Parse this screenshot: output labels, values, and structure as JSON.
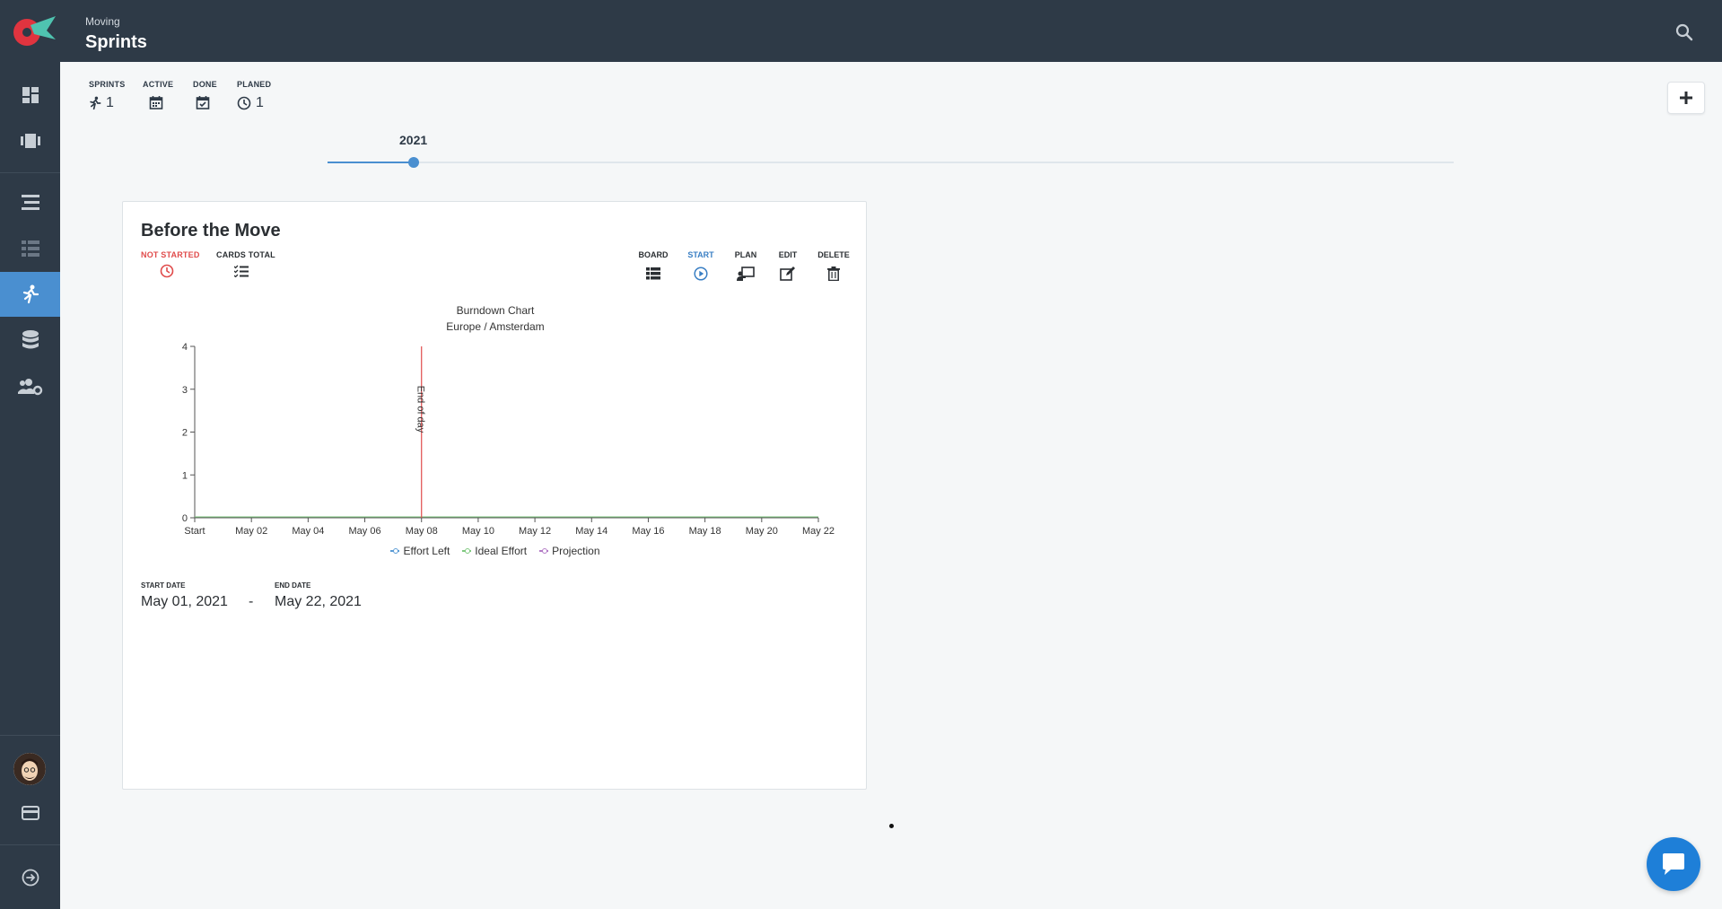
{
  "header": {
    "project": "Moving",
    "title": "Sprints"
  },
  "stats": [
    {
      "label": "SPRINTS",
      "value": "1",
      "icon": "runner-icon"
    },
    {
      "label": "ACTIVE",
      "value": "",
      "icon": "calendar-icon"
    },
    {
      "label": "DONE",
      "value": "",
      "icon": "calendar-check-icon"
    },
    {
      "label": "PLANED",
      "value": "1",
      "icon": "clock-icon"
    }
  ],
  "timeline": {
    "year": "2021"
  },
  "sprint": {
    "title": "Before the Move",
    "status": "NOT STARTED",
    "cards_total_label": "CARDS TOTAL",
    "actions": {
      "board": "BOARD",
      "start": "START",
      "plan": "PLAN",
      "edit": "EDIT",
      "delete": "DELETE"
    },
    "start_date_label": "START DATE",
    "start_date": "May 01, 2021",
    "date_separator": "-",
    "end_date_label": "END DATE",
    "end_date": "May 22, 2021"
  },
  "colors": {
    "topbar": "#2e3a47",
    "accent": "#4a8fd0",
    "status_red": "#e04b4b",
    "marker_red": "#e04b4b"
  },
  "chart_data": {
    "type": "line",
    "title": "Burndown Chart",
    "subtitle": "Europe / Amsterdam",
    "x_tick_labels": [
      "Start",
      "May 02",
      "May 04",
      "May 06",
      "May 08",
      "May 10",
      "May 12",
      "May 14",
      "May 16",
      "May 18",
      "May 20",
      "May 22"
    ],
    "ylim": [
      0,
      4
    ],
    "y_ticks": [
      0,
      1,
      2,
      3,
      4
    ],
    "series": [
      {
        "name": "Effort Left",
        "color": "#5b9bd5",
        "values": []
      },
      {
        "name": "Ideal Effort",
        "color": "#7fc97f",
        "values": []
      },
      {
        "name": "Projection",
        "color": "#b37bc6",
        "values": []
      }
    ],
    "annotations": [
      {
        "x": "May 08",
        "label": "End of day",
        "color": "#e04b4b"
      }
    ],
    "legend": "bottom"
  }
}
